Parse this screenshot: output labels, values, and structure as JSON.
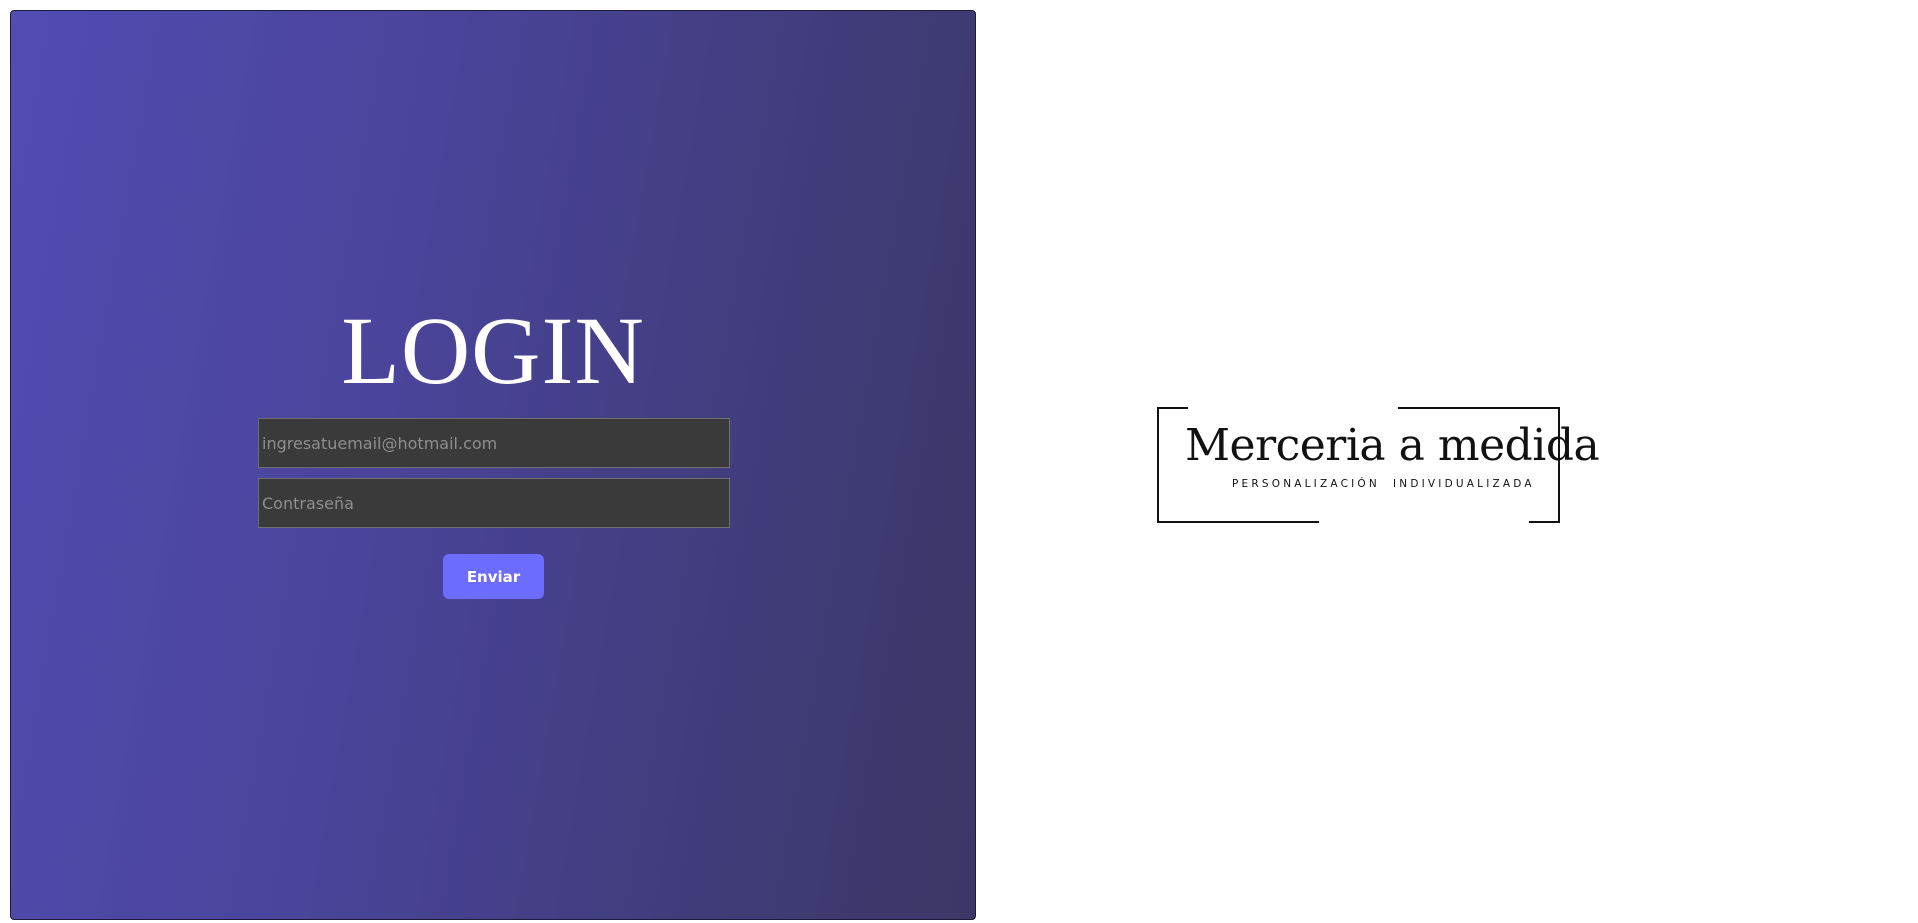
{
  "login": {
    "title": "LOGIN",
    "email_placeholder": "ingresatuemail@hotmail.com",
    "password_placeholder": "Contraseña",
    "submit_label": "Enviar"
  },
  "logo": {
    "title": "Merceria a medida",
    "subtitle": "PERSONALIZACIÓN  INDIVIDUALIZADA"
  },
  "colors": {
    "panel_gradient_start": "#524cb3",
    "panel_gradient_end": "#3b3766",
    "input_background": "#3a3a3a",
    "button_background": "#6c6cff",
    "text_light": "#ffffff"
  }
}
